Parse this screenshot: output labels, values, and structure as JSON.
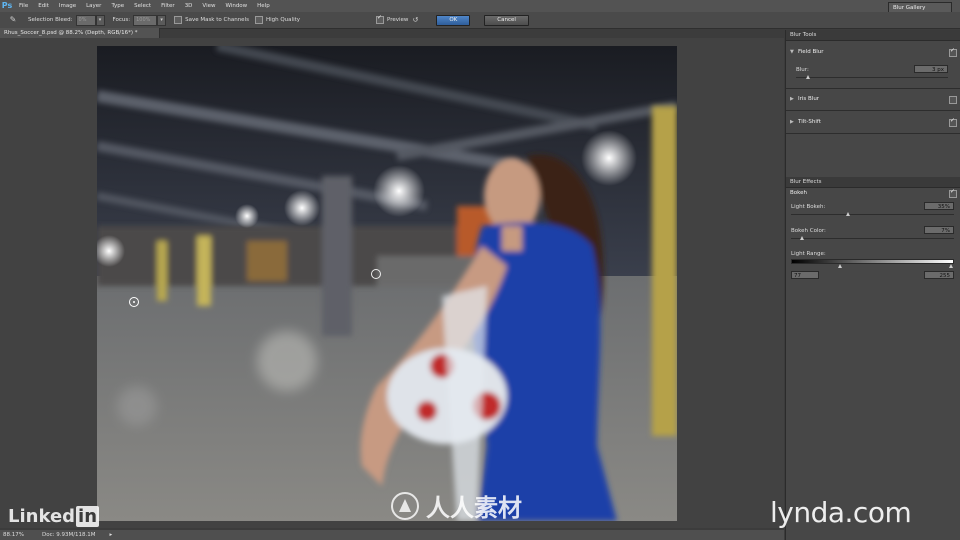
{
  "app": {
    "logo": "Ps"
  },
  "menu": [
    "File",
    "Edit",
    "Image",
    "Layer",
    "Type",
    "Select",
    "Filter",
    "3D",
    "View",
    "Window",
    "Help"
  ],
  "options": {
    "selection_bleed_label": "Selection Bleed:",
    "selection_bleed_value": "0%",
    "focus_label": "Focus:",
    "focus_value": "100%",
    "save_mask_label": "Save Mask to Channels",
    "high_quality_label": "High Quality",
    "preview_label": "Preview",
    "ok_label": "OK",
    "cancel_label": "Cancel",
    "workspace_select": "Blur Gallery"
  },
  "document": {
    "tab_title": "Rhus_Soccer_8.psd @ 88.2% (Depth, RGB/16*) *"
  },
  "status": {
    "zoom": "88.17%",
    "doc_size": "Doc: 9.93M/118.1M"
  },
  "panel": {
    "blur_tools_tab": "Blur Tools",
    "field_blur": {
      "label": "Field Blur",
      "enabled": true,
      "blur_label": "Blur:",
      "blur_value": "3 px"
    },
    "iris_blur": {
      "label": "Iris Blur",
      "enabled": false
    },
    "tilt_shift": {
      "label": "Tilt-Shift",
      "enabled": true
    },
    "blur_effects_tab": "Blur Effects",
    "bokeh_label": "Bokeh",
    "light_bokeh_label": "Light Bokeh:",
    "light_bokeh_value": "35%",
    "bokeh_color_label": "Bokeh Color:",
    "bokeh_color_value": "7%",
    "light_range_label": "Light Range:",
    "light_range_min": "77",
    "light_range_max": "255"
  },
  "watermarks": {
    "linkedin_a": "Linked",
    "linkedin_b": "in",
    "lynda": "lynda.com",
    "center": "人人素材"
  },
  "colors": {
    "accent": "#3f76bb",
    "dress": "#1c3fa8",
    "background": "#3c3c3c"
  }
}
